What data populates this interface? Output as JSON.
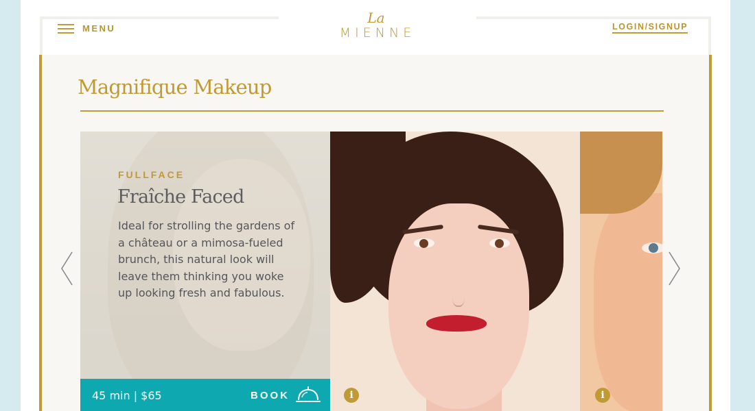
{
  "header": {
    "menu_label": "MENU",
    "logo_top": "La",
    "logo_main": "MIENNE",
    "login_label": "LOGIN/SIGNUP"
  },
  "section": {
    "title": "Magnifique Makeup"
  },
  "carousel": {
    "active_card": {
      "tag": "FULLFACE",
      "heading": "Fraîche Faced",
      "description": "Ideal for strolling the gardens of a château or a mimosa-fueled brunch, this natural look will leave them thinking you woke up looking fresh and fabulous.",
      "meta": "45 min | $65",
      "book_label": "BOOK"
    },
    "info_glyph": "i"
  },
  "colors": {
    "gold": "#c09a35",
    "teal": "#0ea8b1",
    "background": "#d6ebf0",
    "panel": "#f8f7f3"
  },
  "icons": [
    "menu-icon",
    "bell-icon",
    "info-icon",
    "chevron-left-icon",
    "chevron-right-icon"
  ]
}
